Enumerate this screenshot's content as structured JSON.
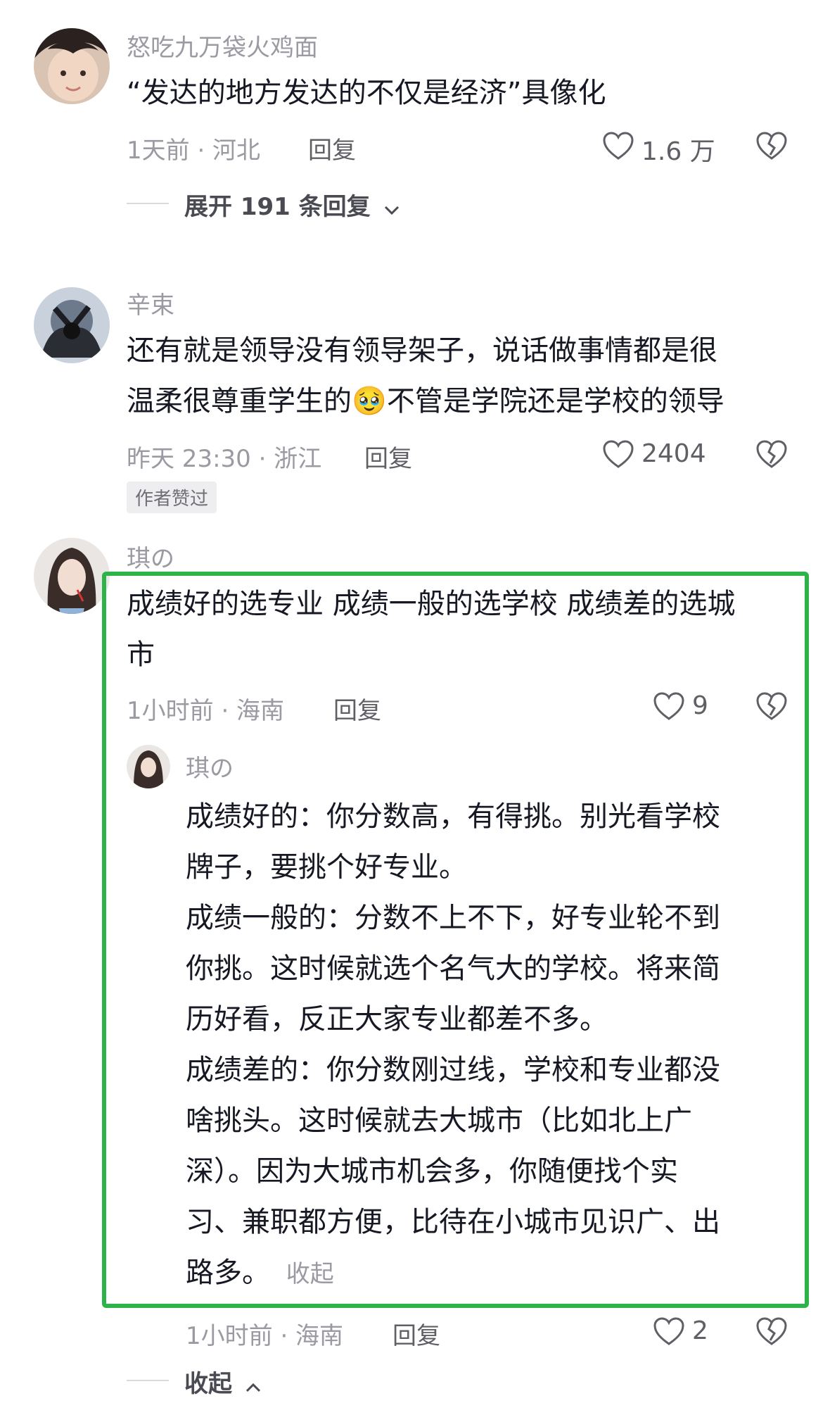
{
  "comments": [
    {
      "username": "怒吃九万袋火鸡面",
      "text": "“发达的地方发达的不仅是经济”具像化",
      "time_location": "1天前 · 河北",
      "reply_label": "回复",
      "likes": "1.6 万",
      "expand_label": "展开 191 条回复"
    },
    {
      "username": "辛束",
      "text_lines": [
        "还有就是领导没有领导架子，说话做事情都是很",
        "温柔很尊重学生的",
        "不管是学院还是学校的领导"
      ],
      "emoji": "🥹",
      "time_location": "昨天 23:30 · 浙江",
      "reply_label": "回复",
      "likes": "2404",
      "author_tag": "作者赞过"
    },
    {
      "username": "琪の",
      "text_lines": [
        "成绩好的选专业 成绩一般的选学校 成绩差的选城",
        "市"
      ],
      "time_location": "1小时前 · 海南",
      "reply_label": "回复",
      "likes": "9",
      "reply": {
        "username": "琪の",
        "text_lines": [
          "成绩好的：你分数高，有得挑。别光看学校",
          "牌子，要挑个好专业。",
          "成绩一般的：分数不上不下，好专业轮不到",
          "你挑。这时候就选个名气大的学校。将来简",
          "历好看，反正大家专业都差不多。",
          "成绩差的：你分数刚过线，学校和专业都没",
          "啥挑头。这时候就去大城市（比如北上广",
          "深）。因为大城市机会多，你随便找个实",
          "习、兼职都方便，比待在小城市见识广、出",
          "路多。"
        ],
        "inline_collapse": "收起",
        "time_location": "1小时前 · 海南",
        "reply_label": "回复",
        "likes": "2"
      },
      "collapse_label": "收起"
    }
  ],
  "colors": {
    "highlight": "#2db34a",
    "text": "#161823",
    "meta": "#9a9aa3"
  }
}
